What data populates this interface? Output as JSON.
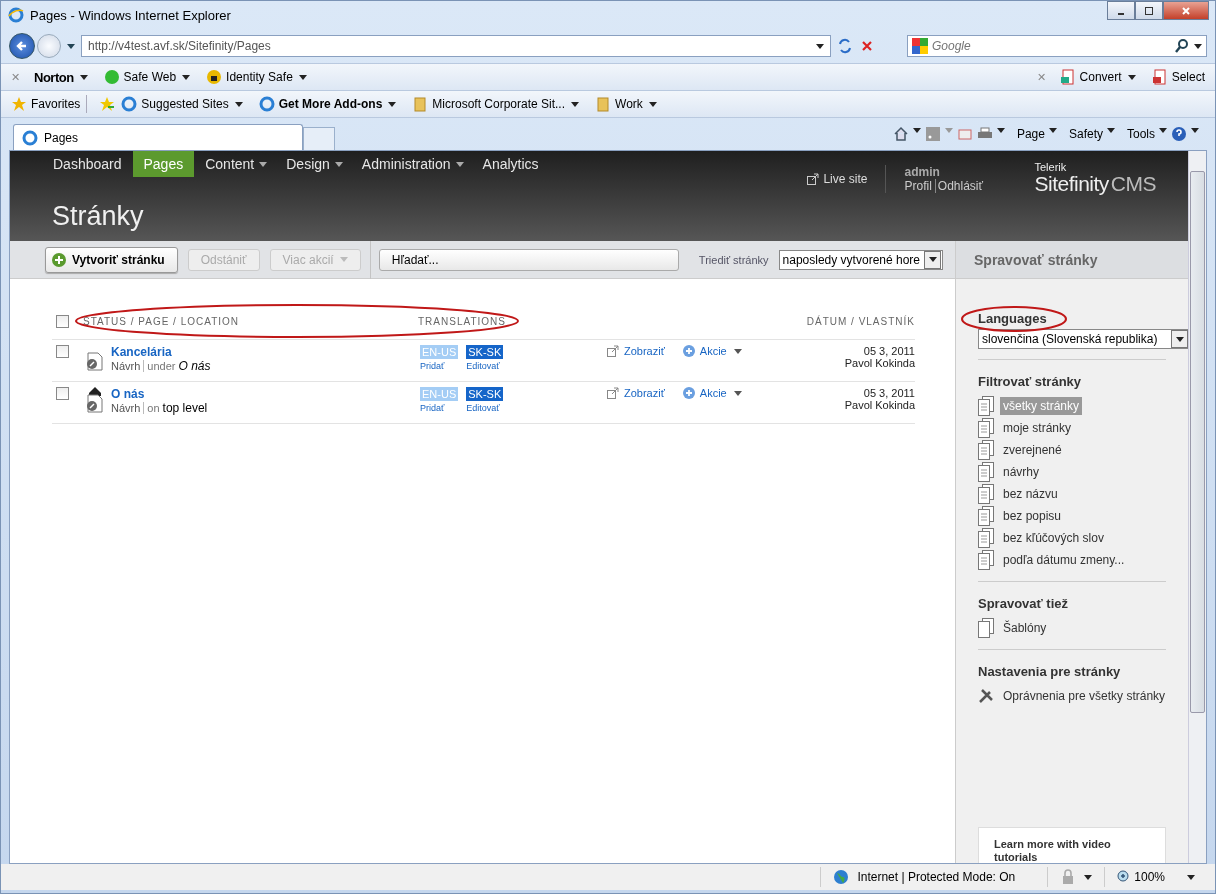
{
  "window": {
    "title": "Pages - Windows Internet Explorer"
  },
  "address_bar": {
    "url": "http://v4test.avf.sk/Sitefinity/Pages",
    "search_placeholder": "Google"
  },
  "norton_bar": {
    "close_left": "✕",
    "close_right": "✕",
    "items": [
      {
        "label": "Norton",
        "kind": "brand"
      },
      {
        "label": "Safe Web",
        "kind": "safeweb"
      },
      {
        "label": "Identity Safe",
        "kind": "identity"
      }
    ],
    "right": [
      {
        "label": "Convert",
        "kind": "convert"
      },
      {
        "label": "Select",
        "kind": "select"
      }
    ]
  },
  "favorites_bar": {
    "items": [
      {
        "label": "Favorites",
        "kind": "star"
      },
      {
        "label": "Suggested Sites",
        "kind": "ie"
      },
      {
        "label": "Get More Add-ons",
        "kind": "ie-bold"
      },
      {
        "label": "Microsoft Corporate Sit...",
        "kind": "folder"
      },
      {
        "label": "Work",
        "kind": "folder"
      }
    ]
  },
  "tabs": [
    {
      "label": "Pages",
      "selected": true
    }
  ],
  "command_bar": [
    "Page",
    "Safety",
    "Tools"
  ],
  "cms": {
    "nav": [
      {
        "label": "Dashboard",
        "selected": false,
        "dropdown": false
      },
      {
        "label": "Pages",
        "selected": true,
        "dropdown": false
      },
      {
        "label": "Content",
        "selected": false,
        "dropdown": true
      },
      {
        "label": "Design",
        "selected": false,
        "dropdown": true
      },
      {
        "label": "Administration",
        "selected": false,
        "dropdown": true
      },
      {
        "label": "Analytics",
        "selected": false,
        "dropdown": false
      }
    ],
    "live_site": "Live site",
    "user": "admin",
    "user_links": [
      "Profil",
      "Odhlásiť"
    ],
    "logo": {
      "vendor": "Telerik",
      "product": "Sitefinity",
      "suffix": "CMS"
    },
    "page_title": "Stránky"
  },
  "toolbar": {
    "buttons": [
      {
        "label": "Vytvoriť stránku",
        "kind": "create",
        "disabled": false,
        "dropdown": false
      },
      {
        "label": "Odstániť",
        "kind": "plain",
        "disabled": true,
        "dropdown": false
      },
      {
        "label": "Viac akcií",
        "kind": "plain",
        "disabled": true,
        "dropdown": true
      },
      {
        "label": "Hľadať...",
        "kind": "search",
        "disabled": false,
        "dropdown": false
      }
    ],
    "sort_label": "Triediť stránky",
    "sort_value": "naposledy vytvorené hore"
  },
  "table": {
    "all_checked": false,
    "columns": [
      "STATUS / PAGE / LOCATION",
      "TRANSLATIONS",
      "DÁTUM / VLASTNÍK"
    ],
    "rows": [
      {
        "checked": false,
        "home": false,
        "title": "Kancelária",
        "status": "Návrh",
        "relation": "under",
        "location": "O nás",
        "location_italic": true,
        "translations": [
          {
            "code": "EN-US",
            "action": "Pridať",
            "translated": false
          },
          {
            "code": "SK-SK",
            "action": "Editovať",
            "translated": true
          }
        ],
        "view": "Zobraziť",
        "actions": "Akcie",
        "date": "05 3, 2011",
        "owner": "Pavol Kokinda"
      },
      {
        "checked": false,
        "home": true,
        "title": "O nás",
        "status": "Návrh",
        "relation": "on",
        "location": "top level",
        "location_italic": false,
        "translations": [
          {
            "code": "EN-US",
            "action": "Pridať",
            "translated": false
          },
          {
            "code": "SK-SK",
            "action": "Editovať",
            "translated": true
          }
        ],
        "view": "Zobraziť",
        "actions": "Akcie",
        "date": "05 3, 2011",
        "owner": "Pavol Kokinda"
      }
    ]
  },
  "sidebar": {
    "title": "Spravovať stránky",
    "languages_heading": "Languages",
    "language": "slovenčina (Slovenská republika)",
    "filter_heading": "Filtrovať stránky",
    "filters": [
      {
        "label": "všetky stránky",
        "selected": true
      },
      {
        "label": "moje stránky",
        "selected": false
      },
      {
        "label": "zverejnené",
        "selected": false
      },
      {
        "label": "návrhy",
        "selected": false
      },
      {
        "label": "bez názvu",
        "selected": false
      },
      {
        "label": "bez popisu",
        "selected": false
      },
      {
        "label": "bez kľúčových slov",
        "selected": false
      },
      {
        "label": "podľa dátumu zmeny...",
        "selected": false
      }
    ],
    "also_heading": "Spravovať tiež",
    "also": [
      "Šablóny"
    ],
    "settings_heading": "Nastavenia pre stránky",
    "settings": [
      "Oprávnenia pre všetky stránky"
    ],
    "tutorial": "Learn more with video tutorials"
  },
  "status_bar": {
    "zone": "Internet | Protected Mode: On",
    "zoom": "100%"
  }
}
